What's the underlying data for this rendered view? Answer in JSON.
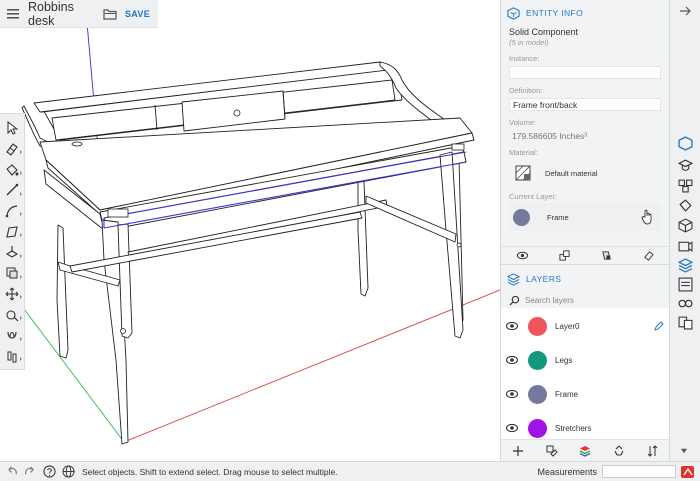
{
  "title_bar": {
    "model_name": "Robbins desk",
    "save_label": "SAVE"
  },
  "entity_info": {
    "header": "ENTITY INFO",
    "selection_type": "Solid Component",
    "instance_count": "(5 in model)",
    "instance_label": "Instance:",
    "instance_value": "",
    "definition_label": "Definition:",
    "definition_value": "Frame front/back",
    "volume_label": "Volume:",
    "volume_value": "179.586605 Inches³",
    "material_label": "Material:",
    "material_value": "Default material",
    "layer_label": "Current Layer:",
    "layer_value": "Frame",
    "layer_color": "#757a9c"
  },
  "layers": {
    "header": "LAYERS",
    "search_placeholder": "Search layers",
    "items": [
      {
        "name": "Layer0",
        "color": "#f0545c",
        "visible": true,
        "active": true
      },
      {
        "name": "Legs",
        "color": "#14967f",
        "visible": true,
        "active": false
      },
      {
        "name": "Frame",
        "color": "#757a9c",
        "visible": true,
        "active": false
      },
      {
        "name": "Stretchers",
        "color": "#a012e6",
        "visible": true,
        "active": false
      }
    ]
  },
  "status_bar": {
    "message": "Select objects. Shift to extend select. Drag mouse to select multiple.",
    "measurements_label": "Measurements",
    "measurements_value": ""
  },
  "toolbar_icons": [
    "select-icon",
    "eraser-icon",
    "paint-bucket-icon",
    "line-icon",
    "arc-icon",
    "rectangle-icon",
    "push-pull-icon",
    "offset-icon",
    "move-icon",
    "tape-measure-icon",
    "orbit-icon",
    "walk-icon"
  ],
  "rail_icons": [
    "entity-info-icon",
    "instructor-icon",
    "components-icon",
    "materials-icon",
    "styles-icon",
    "scenes-icon",
    "layers-icon",
    "outliner-icon",
    "display-icon",
    "views-icon"
  ],
  "colors": {
    "accent": "#2a7ac6",
    "panel_bg": "#f1f3f4",
    "selection_blue": "#3636d6",
    "axis_red": "#d84545",
    "axis_green": "#3cb44b"
  }
}
